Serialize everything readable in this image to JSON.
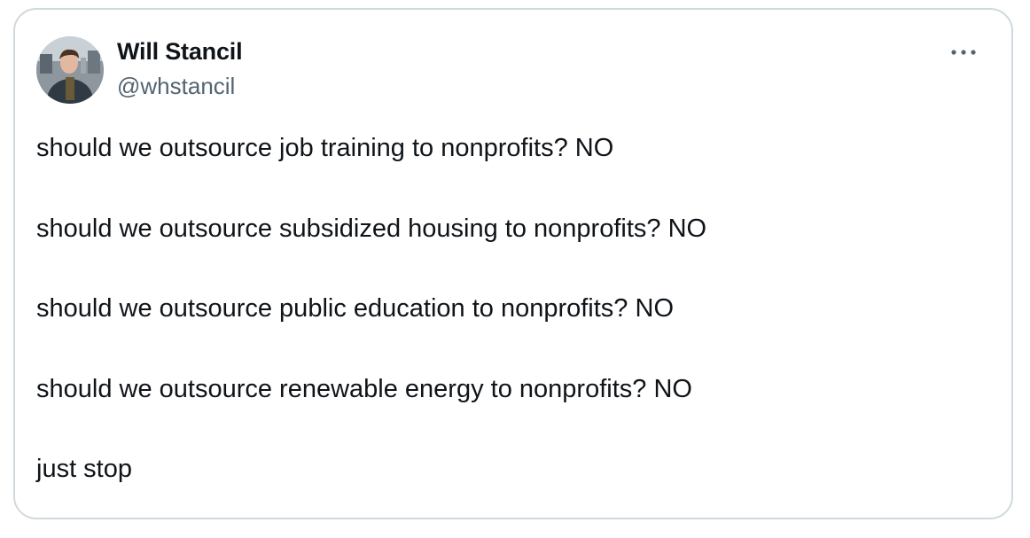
{
  "author": {
    "name": "Will Stancil",
    "handle": "@whstancil"
  },
  "menu": {
    "more_icon": "more-horizontal-icon"
  },
  "tweet": {
    "lines": [
      "should we outsource job training to nonprofits? NO",
      "should we outsource subsidized housing to nonprofits? NO",
      "should we outsource public education to nonprofits? NO",
      "should we outsource renewable energy to nonprofits? NO",
      "just stop"
    ]
  },
  "colors": {
    "text": "#0f1419",
    "secondary": "#536471",
    "border": "#cfd9de"
  }
}
